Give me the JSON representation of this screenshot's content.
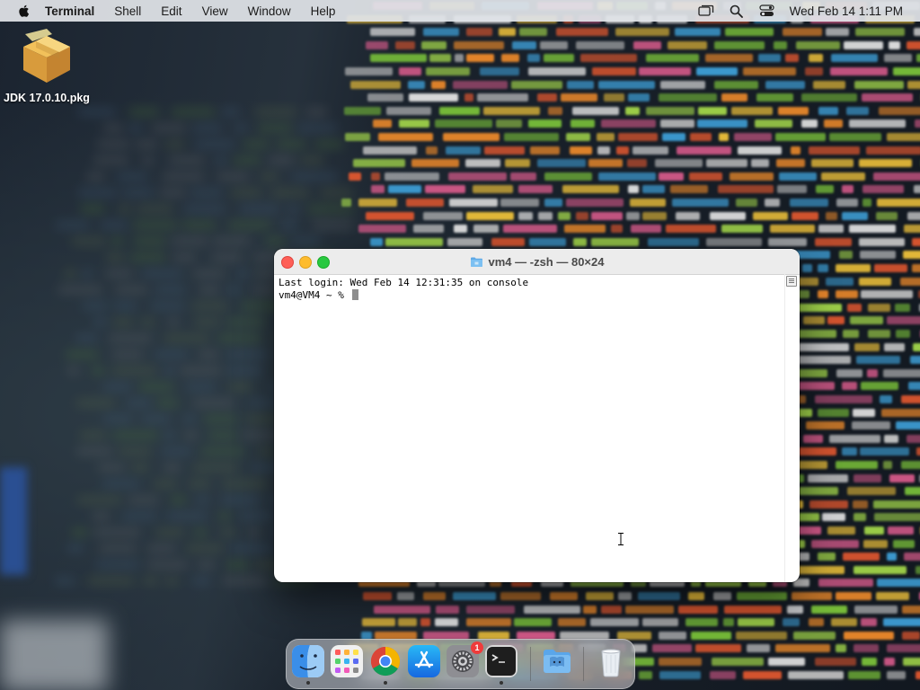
{
  "menubar": {
    "app_name": "Terminal",
    "menus": [
      "Shell",
      "Edit",
      "View",
      "Window",
      "Help"
    ],
    "clock": "Wed Feb 14  1:11 PM",
    "status_icons": [
      "screen-mirroring-icon",
      "search-icon",
      "control-center-icon"
    ]
  },
  "desktop": {
    "icons": [
      {
        "label": "JDK 17.0.10.pkg",
        "icon": "package-icon"
      }
    ]
  },
  "terminal": {
    "title": "vm4 — -zsh — 80×24",
    "lines": [
      "Last login: Wed Feb 14 12:31:35 on console",
      "vm4@VM4 ~ % "
    ]
  },
  "dock": {
    "apps": [
      {
        "name": "Finder",
        "icon": "finder-icon",
        "running": true
      },
      {
        "name": "Launchpad",
        "icon": "launchpad-icon",
        "running": false
      },
      {
        "name": "Google Chrome",
        "icon": "chrome-icon",
        "running": true
      },
      {
        "name": "App Store",
        "icon": "app-store-icon",
        "running": false
      },
      {
        "name": "System Settings",
        "icon": "system-settings-icon",
        "running": false,
        "badge": "1"
      },
      {
        "name": "Terminal",
        "icon": "terminal-icon",
        "running": true
      },
      {
        "name": "Downloads",
        "icon": "downloads-folder-icon",
        "running": false
      },
      {
        "name": "Trash",
        "icon": "trash-icon",
        "running": false
      }
    ]
  },
  "colors": {
    "close": "#fe5f57",
    "minimize": "#febc2e",
    "zoom": "#28c840",
    "badge": "#ef3b3b"
  }
}
